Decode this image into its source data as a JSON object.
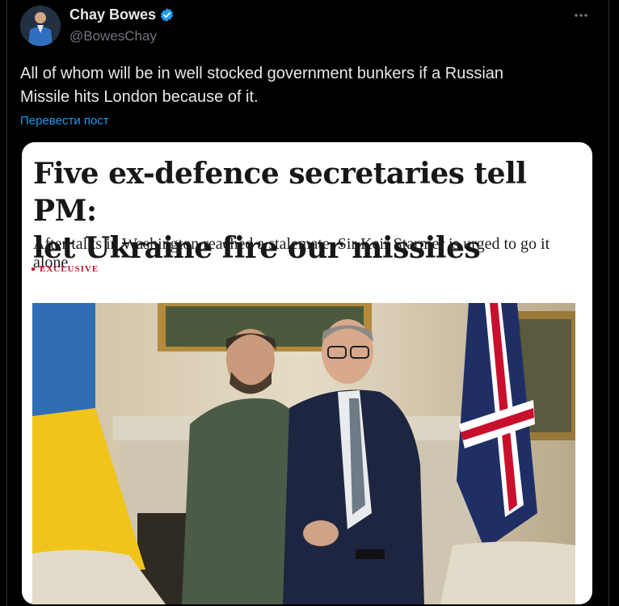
{
  "author": {
    "name": "Chay Bowes",
    "handle": "@BowesChay",
    "verified": true,
    "avatar_icon": "avatar"
  },
  "more_icon": "more-horizontal-icon",
  "tweet": {
    "text_line1": "All of whom will be in well stocked government bunkers if a Russian",
    "text_line2": "Missile hits London because of it.",
    "translate_label": "Перевести пост"
  },
  "article": {
    "headline_line1": "Five ex-defence secretaries tell PM:",
    "headline_line2": "let Ukraine fire our missiles",
    "subheadline": "After talks in Washington reached a stalemate, Sir Keir Starmer is urged to go it alone",
    "tag": "EXCLUSIVE",
    "photo_alt": "photo"
  },
  "colors": {
    "background": "#000000",
    "text": "#e7e9ea",
    "muted": "#71767b",
    "link": "#1d9bf0",
    "verified": "#1d9bf0",
    "exclusive": "#c4122f"
  }
}
